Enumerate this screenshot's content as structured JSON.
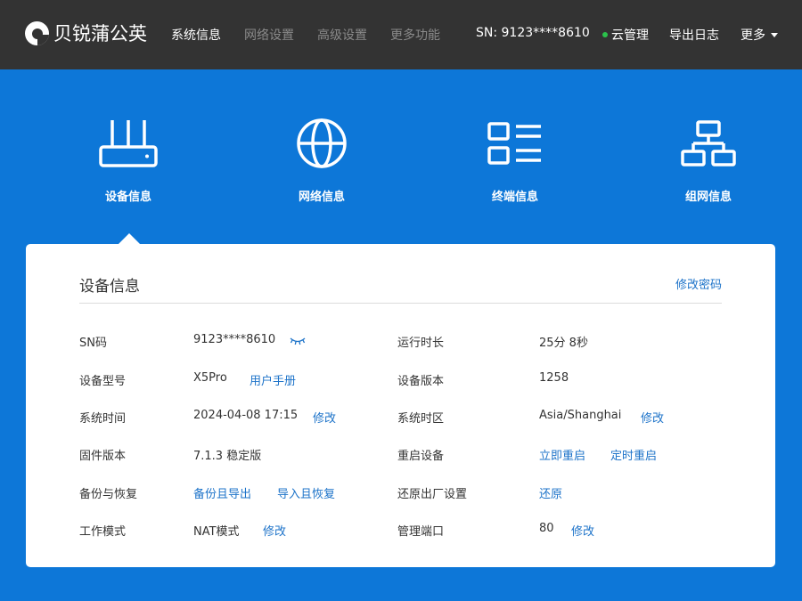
{
  "header": {
    "brand": "贝锐蒲公英",
    "nav": [
      {
        "label": "系统信息"
      },
      {
        "label": "网络设置"
      },
      {
        "label": "高级设置"
      },
      {
        "label": "更多功能"
      }
    ],
    "sn_text": "SN:  9123****8610",
    "cloud_label": "云管理",
    "export_log": "导出日志",
    "more": "更多"
  },
  "categories": [
    {
      "label": "设备信息",
      "icon": "router-icon"
    },
    {
      "label": "网络信息",
      "icon": "globe-icon"
    },
    {
      "label": "终端信息",
      "icon": "list-icon"
    },
    {
      "label": "组网信息",
      "icon": "network-topology-icon"
    }
  ],
  "panel": {
    "title": "设备信息",
    "change_password": "修改密码",
    "left": {
      "sn_label": "SN码",
      "sn_value": "9123****8610",
      "model_label": "设备型号",
      "model_value": "X5Pro",
      "manual_link": "用户手册",
      "time_label": "系统时间",
      "time_value": "2024-04-08 17:15",
      "time_edit": "修改",
      "firmware_label": "固件版本",
      "firmware_value": "7.1.3 稳定版",
      "backup_label": "备份与恢复",
      "backup_export": "备份且导出",
      "backup_import": "导入且恢复",
      "mode_label": "工作模式",
      "mode_value": "NAT模式",
      "mode_edit": "修改"
    },
    "right": {
      "uptime_label": "运行时长",
      "uptime_value": "25分 8秒",
      "version_label": "设备版本",
      "version_value": "1258",
      "tz_label": "系统时区",
      "tz_value": "Asia/Shanghai",
      "tz_edit": "修改",
      "reboot_label": "重启设备",
      "reboot_now": "立即重启",
      "reboot_scheduled": "定时重启",
      "reset_label": "还原出厂设置",
      "reset_link": "还原",
      "port_label": "管理端口",
      "port_value": "80",
      "port_edit": "修改"
    }
  },
  "colors": {
    "topbar": "#333333",
    "primary_blue": "#0d77d8",
    "link_blue": "#1d73c9",
    "online_green": "#2bc24b"
  }
}
